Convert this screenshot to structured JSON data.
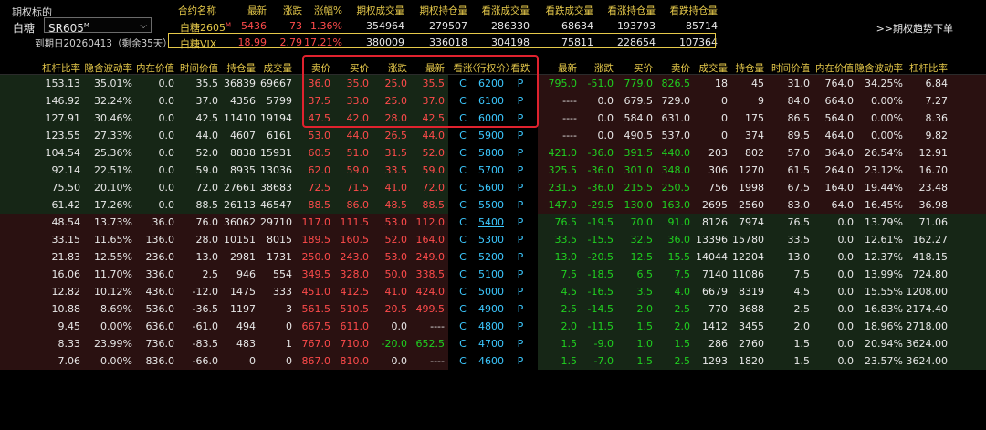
{
  "top": {
    "underlying_label": "期权标的",
    "symbol_name": "白糖",
    "contract_code": "SR605",
    "contract_sup": "M",
    "expiry": "到期日20260413（剩余35天）",
    "trend_link": ">>期权趋势下单",
    "summary_headers": [
      "合约名称",
      "最新",
      "涨跌",
      "涨幅%",
      "期权成交量",
      "期权持仓量",
      "看涨成交量",
      "看跌成交量",
      "看涨持仓量",
      "看跌持仓量"
    ],
    "row1": {
      "name": "白糖2605",
      "sup": "M",
      "latest": "5436",
      "change": "73",
      "pct": "1.36%",
      "opt_vol": "354964",
      "opt_oi": "279507",
      "call_vol": "286330",
      "put_vol": "68634",
      "call_oi": "193793",
      "put_oi": "85714"
    },
    "row2": {
      "name": "白糖VIX",
      "latest": "18.99",
      "change": "2.79",
      "pct": "17.21%",
      "opt_vol": "380009",
      "opt_oi": "336018",
      "call_vol": "304198",
      "put_vol": "75811",
      "call_oi": "228654",
      "put_oi": "107364"
    }
  },
  "headers": [
    "杠杆比率",
    "隐含波动率",
    "内在价值",
    "时间价值",
    "持仓量",
    "成交量",
    "卖价",
    "买价",
    "涨跌",
    "最新",
    "看涨",
    "〈行权价〉",
    "看跌",
    "最新",
    "涨跌",
    "买价",
    "卖价",
    "成交量",
    "持仓量",
    "时间价值",
    "内在价值",
    "隐含波动率",
    "杠杆比率"
  ],
  "rows": [
    [
      "153.13",
      "35.01%",
      "0.0",
      "35.5",
      "36839",
      "69667",
      "36.0",
      "35.0",
      "25.0",
      "35.5",
      "C",
      "6200",
      "P",
      "795.0",
      "-51.0",
      "779.0",
      "826.5",
      "18",
      "45",
      "31.0",
      "764.0",
      "34.25%",
      "6.84"
    ],
    [
      "146.92",
      "32.24%",
      "0.0",
      "37.0",
      "4356",
      "5799",
      "37.5",
      "33.0",
      "25.0",
      "37.0",
      "C",
      "6100",
      "P",
      "----",
      "0.0",
      "679.5",
      "729.0",
      "0",
      "9",
      "84.0",
      "664.0",
      "0.00%",
      "7.27"
    ],
    [
      "127.91",
      "30.46%",
      "0.0",
      "42.5",
      "11410",
      "19194",
      "47.5",
      "42.0",
      "28.0",
      "42.5",
      "C",
      "6000",
      "P",
      "----",
      "0.0",
      "584.0",
      "631.0",
      "0",
      "175",
      "86.5",
      "564.0",
      "0.00%",
      "8.36"
    ],
    [
      "123.55",
      "27.33%",
      "0.0",
      "44.0",
      "4607",
      "6161",
      "53.0",
      "44.0",
      "26.5",
      "44.0",
      "C",
      "5900",
      "P",
      "----",
      "0.0",
      "490.5",
      "537.0",
      "0",
      "374",
      "89.5",
      "464.0",
      "0.00%",
      "9.82"
    ],
    [
      "104.54",
      "25.36%",
      "0.0",
      "52.0",
      "8838",
      "15931",
      "60.5",
      "51.0",
      "31.5",
      "52.0",
      "C",
      "5800",
      "P",
      "421.0",
      "-36.0",
      "391.5",
      "440.0",
      "203",
      "802",
      "57.0",
      "364.0",
      "26.54%",
      "12.91"
    ],
    [
      "92.14",
      "22.51%",
      "0.0",
      "59.0",
      "8935",
      "13036",
      "62.0",
      "59.0",
      "33.5",
      "59.0",
      "C",
      "5700",
      "P",
      "325.5",
      "-36.0",
      "301.0",
      "348.0",
      "306",
      "1270",
      "61.5",
      "264.0",
      "23.12%",
      "16.70"
    ],
    [
      "75.50",
      "20.10%",
      "0.0",
      "72.0",
      "27661",
      "38683",
      "72.5",
      "71.5",
      "41.0",
      "72.0",
      "C",
      "5600",
      "P",
      "231.5",
      "-36.0",
      "215.5",
      "250.5",
      "756",
      "1998",
      "67.5",
      "164.0",
      "19.44%",
      "23.48"
    ],
    [
      "61.42",
      "17.26%",
      "0.0",
      "88.5",
      "26113",
      "46547",
      "88.5",
      "86.0",
      "48.5",
      "88.5",
      "C",
      "5500",
      "P",
      "147.0",
      "-29.5",
      "130.0",
      "163.0",
      "2695",
      "2560",
      "83.0",
      "64.0",
      "16.45%",
      "36.98"
    ],
    [
      "48.54",
      "13.73%",
      "36.0",
      "76.0",
      "36062",
      "29710",
      "117.0",
      "111.5",
      "53.0",
      "112.0",
      "C",
      "5400",
      "P",
      "76.5",
      "-19.5",
      "70.0",
      "91.0",
      "8126",
      "7974",
      "76.5",
      "0.0",
      "13.79%",
      "71.06"
    ],
    [
      "33.15",
      "11.65%",
      "136.0",
      "28.0",
      "10151",
      "8015",
      "189.5",
      "160.5",
      "52.0",
      "164.0",
      "C",
      "5300",
      "P",
      "33.5",
      "-15.5",
      "32.5",
      "36.0",
      "13396",
      "15780",
      "33.5",
      "0.0",
      "12.61%",
      "162.27"
    ],
    [
      "21.83",
      "12.55%",
      "236.0",
      "13.0",
      "2981",
      "1731",
      "250.0",
      "243.0",
      "53.0",
      "249.0",
      "C",
      "5200",
      "P",
      "13.0",
      "-20.5",
      "12.5",
      "15.5",
      "14044",
      "12204",
      "13.0",
      "0.0",
      "12.37%",
      "418.15"
    ],
    [
      "16.06",
      "11.70%",
      "336.0",
      "2.5",
      "946",
      "554",
      "349.5",
      "328.0",
      "50.0",
      "338.5",
      "C",
      "5100",
      "P",
      "7.5",
      "-18.5",
      "6.5",
      "7.5",
      "7140",
      "11086",
      "7.5",
      "0.0",
      "13.99%",
      "724.80"
    ],
    [
      "12.82",
      "10.12%",
      "436.0",
      "-12.0",
      "1475",
      "333",
      "451.0",
      "412.5",
      "41.0",
      "424.0",
      "C",
      "5000",
      "P",
      "4.5",
      "-16.5",
      "3.5",
      "4.0",
      "6679",
      "8319",
      "4.5",
      "0.0",
      "15.55%",
      "1208.00"
    ],
    [
      "10.88",
      "8.69%",
      "536.0",
      "-36.5",
      "1197",
      "3",
      "561.5",
      "510.5",
      "20.5",
      "499.5",
      "C",
      "4900",
      "P",
      "2.5",
      "-14.5",
      "2.0",
      "2.5",
      "770",
      "3688",
      "2.5",
      "0.0",
      "16.83%",
      "2174.40"
    ],
    [
      "9.45",
      "0.00%",
      "636.0",
      "-61.0",
      "494",
      "0",
      "667.5",
      "611.0",
      "0.0",
      "----",
      "C",
      "4800",
      "P",
      "2.0",
      "-11.5",
      "1.5",
      "2.0",
      "1412",
      "3455",
      "2.0",
      "0.0",
      "18.96%",
      "2718.00"
    ],
    [
      "8.33",
      "23.99%",
      "736.0",
      "-83.5",
      "483",
      "1",
      "767.0",
      "710.0",
      "-20.0",
      "652.5",
      "C",
      "4700",
      "P",
      "1.5",
      "-9.0",
      "1.0",
      "1.5",
      "286",
      "2760",
      "1.5",
      "0.0",
      "20.94%",
      "3624.00"
    ],
    [
      "7.06",
      "0.00%",
      "836.0",
      "-66.0",
      "0",
      "0",
      "867.0",
      "810.0",
      "0.0",
      "----",
      "C",
      "4600",
      "P",
      "1.5",
      "-7.0",
      "1.5",
      "2.5",
      "1293",
      "1820",
      "1.5",
      "0.0",
      "23.57%",
      "3624.00"
    ]
  ],
  "colors": {
    "call_otm_bg": "#162616",
    "call_itm_bg": "#2a1111",
    "put_itm_bg": "#2a1111",
    "put_otm_bg": "#162616",
    "highlight": "#e0222e",
    "header": "#e6c94a"
  }
}
